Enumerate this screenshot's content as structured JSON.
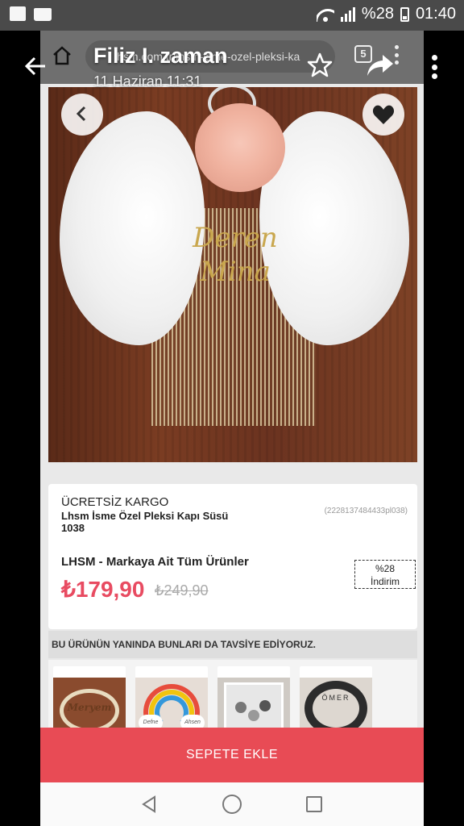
{
  "status_bar": {
    "battery_percent": "%28",
    "time": "01:40"
  },
  "viewer": {
    "sender": "Filiz I. zaman",
    "date": "11 Haziran 11:31"
  },
  "browser": {
    "url": "lhsm.com.tr/lhsm-isme-ozel-pleksi-ka",
    "tab_count": "5"
  },
  "product": {
    "nameplate_text": "Deren Mina",
    "shipping": "ÜCRETSİZ KARGO",
    "name": "Lhsm İsme Özel Pleksi Kapı Süsü 1038",
    "code": "(2228137484433pl038)",
    "brand_link": "LHSM - Markaya Ait Tüm Ürünler",
    "price": "₺179,90",
    "old_price": "₺249,90",
    "discount_percent": "%28",
    "discount_label": "İndirim"
  },
  "recommendations": {
    "heading": "BU ÜRÜNÜN YANINDA BUNLARI DA TAVSİYE EDİYORUZ.",
    "items": [
      {
        "label": "Meryem"
      },
      {
        "label_left": "Defne",
        "label_right": "Ahsen"
      },
      {
        "label": ""
      },
      {
        "label": "ÖMER"
      }
    ]
  },
  "cart_button": "SEPETE EKLE",
  "colors": {
    "accent": "#e84b55",
    "price": "#e84b61"
  }
}
